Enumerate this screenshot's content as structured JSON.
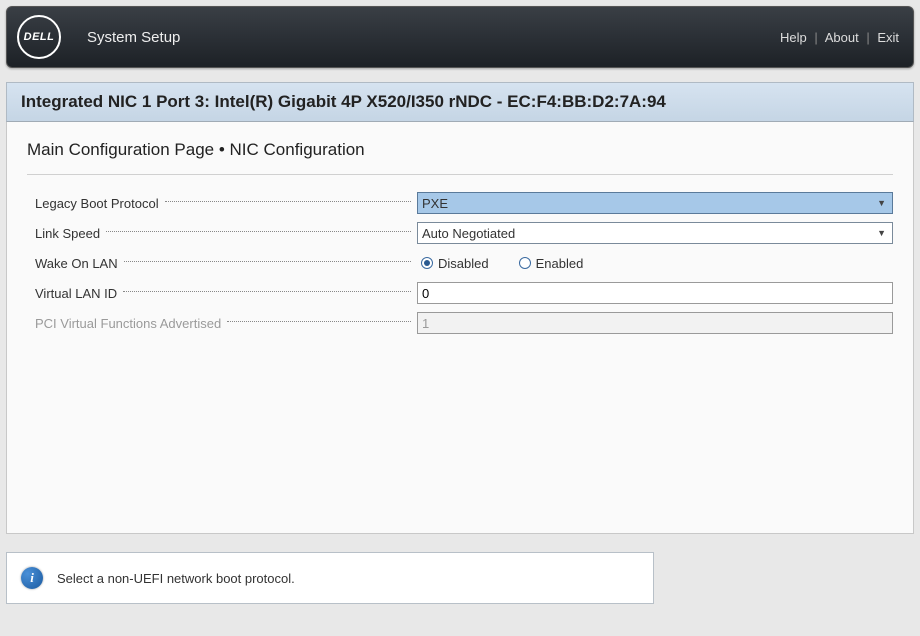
{
  "header": {
    "logo_text": "DELL",
    "title": "System Setup",
    "links": {
      "help": "Help",
      "about": "About",
      "exit": "Exit"
    }
  },
  "page_title": "Integrated NIC 1 Port 3: Intel(R) Gigabit 4P X520/I350 rNDC - EC:F4:BB:D2:7A:94",
  "breadcrumb": "Main Configuration Page • NIC Configuration",
  "form": {
    "legacy_boot_protocol": {
      "label": "Legacy Boot Protocol",
      "value": "PXE"
    },
    "link_speed": {
      "label": "Link Speed",
      "value": "Auto Negotiated"
    },
    "wake_on_lan": {
      "label": "Wake On LAN",
      "disabled_label": "Disabled",
      "enabled_label": "Enabled",
      "selected": "Disabled"
    },
    "virtual_lan_id": {
      "label": "Virtual LAN ID",
      "value": "0"
    },
    "pci_vf_advertised": {
      "label": "PCI Virtual Functions Advertised",
      "value": "1"
    }
  },
  "help_text": "Select a non-UEFI network boot protocol."
}
